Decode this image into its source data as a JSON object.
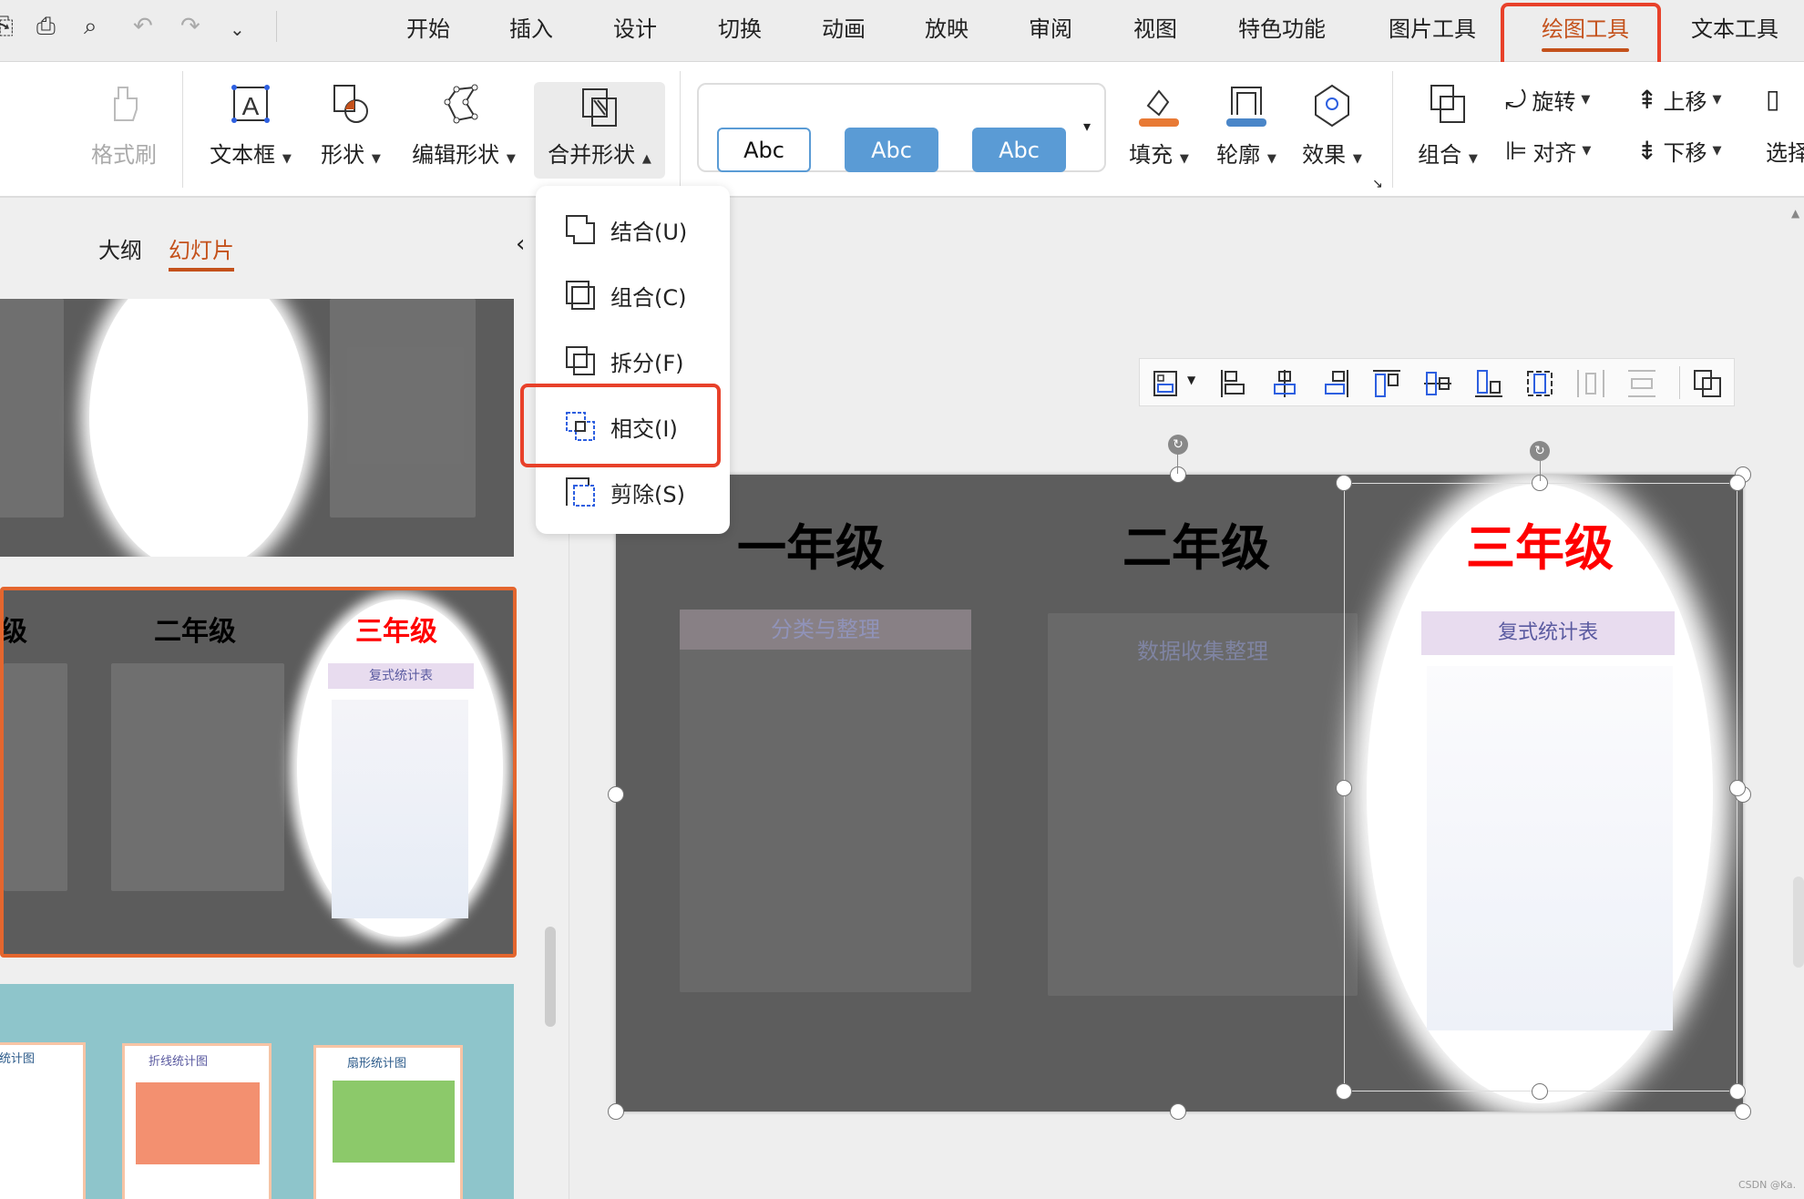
{
  "quick_access": {
    "icons": [
      "save-icon",
      "print-icon",
      "print-preview-icon",
      "undo-icon",
      "redo-icon",
      "more-icon"
    ]
  },
  "tabs": [
    "开始",
    "插入",
    "设计",
    "切换",
    "动画",
    "放映",
    "审阅",
    "视图",
    "特色功能",
    "图片工具",
    "绘图工具",
    "文本工具"
  ],
  "active_tab": "绘图工具",
  "ribbon": {
    "format_painter": "格式刷",
    "textbox": "文本框",
    "shape": "形状",
    "edit_shape": "编辑形状",
    "merge_shape": "合并形状",
    "styles": [
      "Abc",
      "Abc",
      "Abc"
    ],
    "fill": "填充",
    "outline": "轮廓",
    "effect": "效果",
    "group": "组合",
    "rotate": "旋转",
    "align": "对齐",
    "bring_forward": "上移",
    "send_backward": "下移",
    "select": "选择",
    "colors": {
      "fill": "#e87a35",
      "outline": "#4a86c8",
      "style_blue": "#5a9bd5"
    }
  },
  "merge_menu": {
    "items": [
      "结合(U)",
      "组合(C)",
      "拆分(F)",
      "相交(I)",
      "剪除(S)"
    ],
    "highlighted": "相交(I)"
  },
  "left_panel": {
    "tabs": [
      "大纲",
      "幻灯片"
    ],
    "active": "幻灯片",
    "thumb2_titles": [
      "级",
      "二年级",
      "三年级"
    ],
    "thumb2_book": "复式统计表",
    "thumb3_books": [
      "统计图",
      "折线统计图",
      "扇形统计图"
    ]
  },
  "slide": {
    "titles": [
      "一年级",
      "二年级",
      "三年级"
    ],
    "books": [
      "分类与整理",
      "数据收集整理",
      "复式统计表"
    ],
    "accent": "#ff0000"
  },
  "watermark": "CSDN @Ka."
}
